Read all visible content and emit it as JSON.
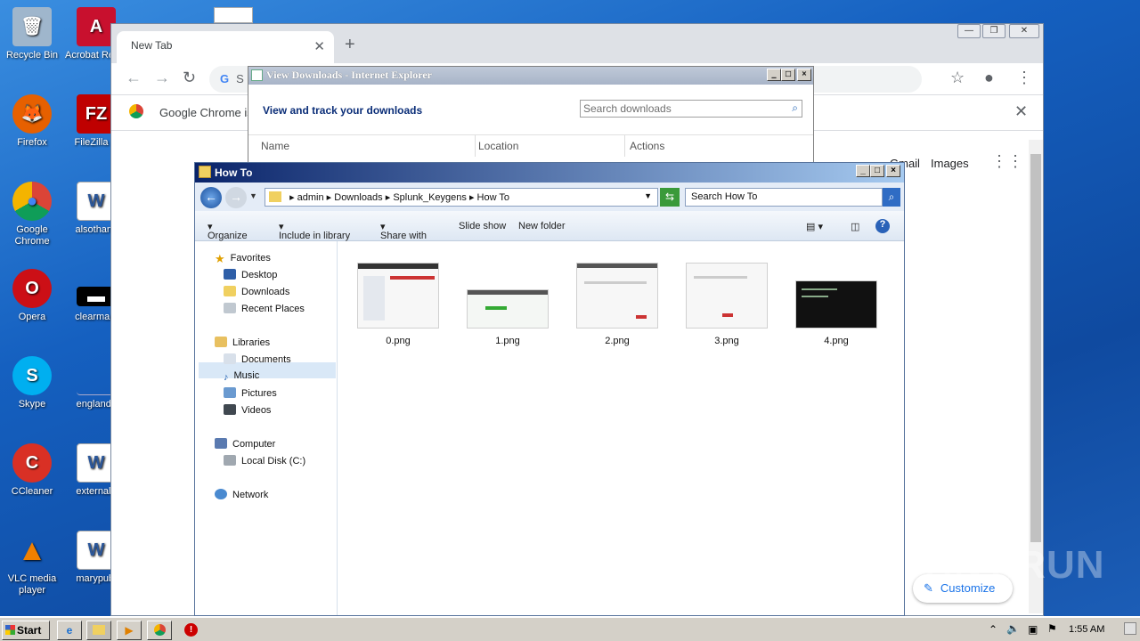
{
  "desktop": {
    "icons": [
      {
        "label": "Recycle Bin",
        "glyph": "🗑"
      },
      {
        "label": "Acrobat Reader",
        "glyph": "A"
      },
      {
        "label": "Firefox",
        "glyph": "🦊"
      },
      {
        "label": "FileZilla C",
        "glyph": "FZ"
      },
      {
        "label": "Google Chrome",
        "glyph": "●"
      },
      {
        "label": "alsothank",
        "glyph": "W"
      },
      {
        "label": "Opera",
        "glyph": "O"
      },
      {
        "label": "clearmani",
        "glyph": "▬"
      },
      {
        "label": "Skype",
        "glyph": "S"
      },
      {
        "label": "englands",
        "glyph": ""
      },
      {
        "label": "CCleaner",
        "glyph": "C"
      },
      {
        "label": "externala",
        "glyph": "W"
      },
      {
        "label": "VLC media player",
        "glyph": "▲"
      },
      {
        "label": "marypubl",
        "glyph": "W"
      }
    ]
  },
  "chrome": {
    "tab_title": "New Tab",
    "new_tab": "+",
    "omnibox_text": "S",
    "info_text": "Google Chrome is",
    "links": {
      "gmail": "Gmail",
      "images": "Images"
    },
    "customize": "Customize"
  },
  "ie": {
    "title": "View Downloads - Internet Explorer",
    "heading": "View and track your downloads",
    "search_placeholder": "Search downloads",
    "columns": [
      "Name",
      "Location",
      "Actions"
    ]
  },
  "explorer": {
    "title": "How To",
    "breadcrumb": [
      "admin",
      "Downloads",
      "Splunk_Keygens",
      "How To"
    ],
    "search_placeholder": "Search How To",
    "commands": [
      "Organize",
      "Include in library",
      "Share with",
      "Slide show",
      "New folder"
    ],
    "nav": {
      "favorites": "Favorites",
      "favorites_items": [
        "Desktop",
        "Downloads",
        "Recent Places"
      ],
      "libraries": "Libraries",
      "libraries_items": [
        "Documents",
        "Music",
        "Pictures",
        "Videos"
      ],
      "computer": "Computer",
      "computer_items": [
        "Local Disk (C:)"
      ],
      "network": "Network"
    },
    "files": [
      "0.png",
      "1.png",
      "2.png",
      "3.png",
      "4.png"
    ]
  },
  "taskbar": {
    "start": "Start",
    "clock": "1:55 AM"
  },
  "watermark": "ANY.RUN"
}
